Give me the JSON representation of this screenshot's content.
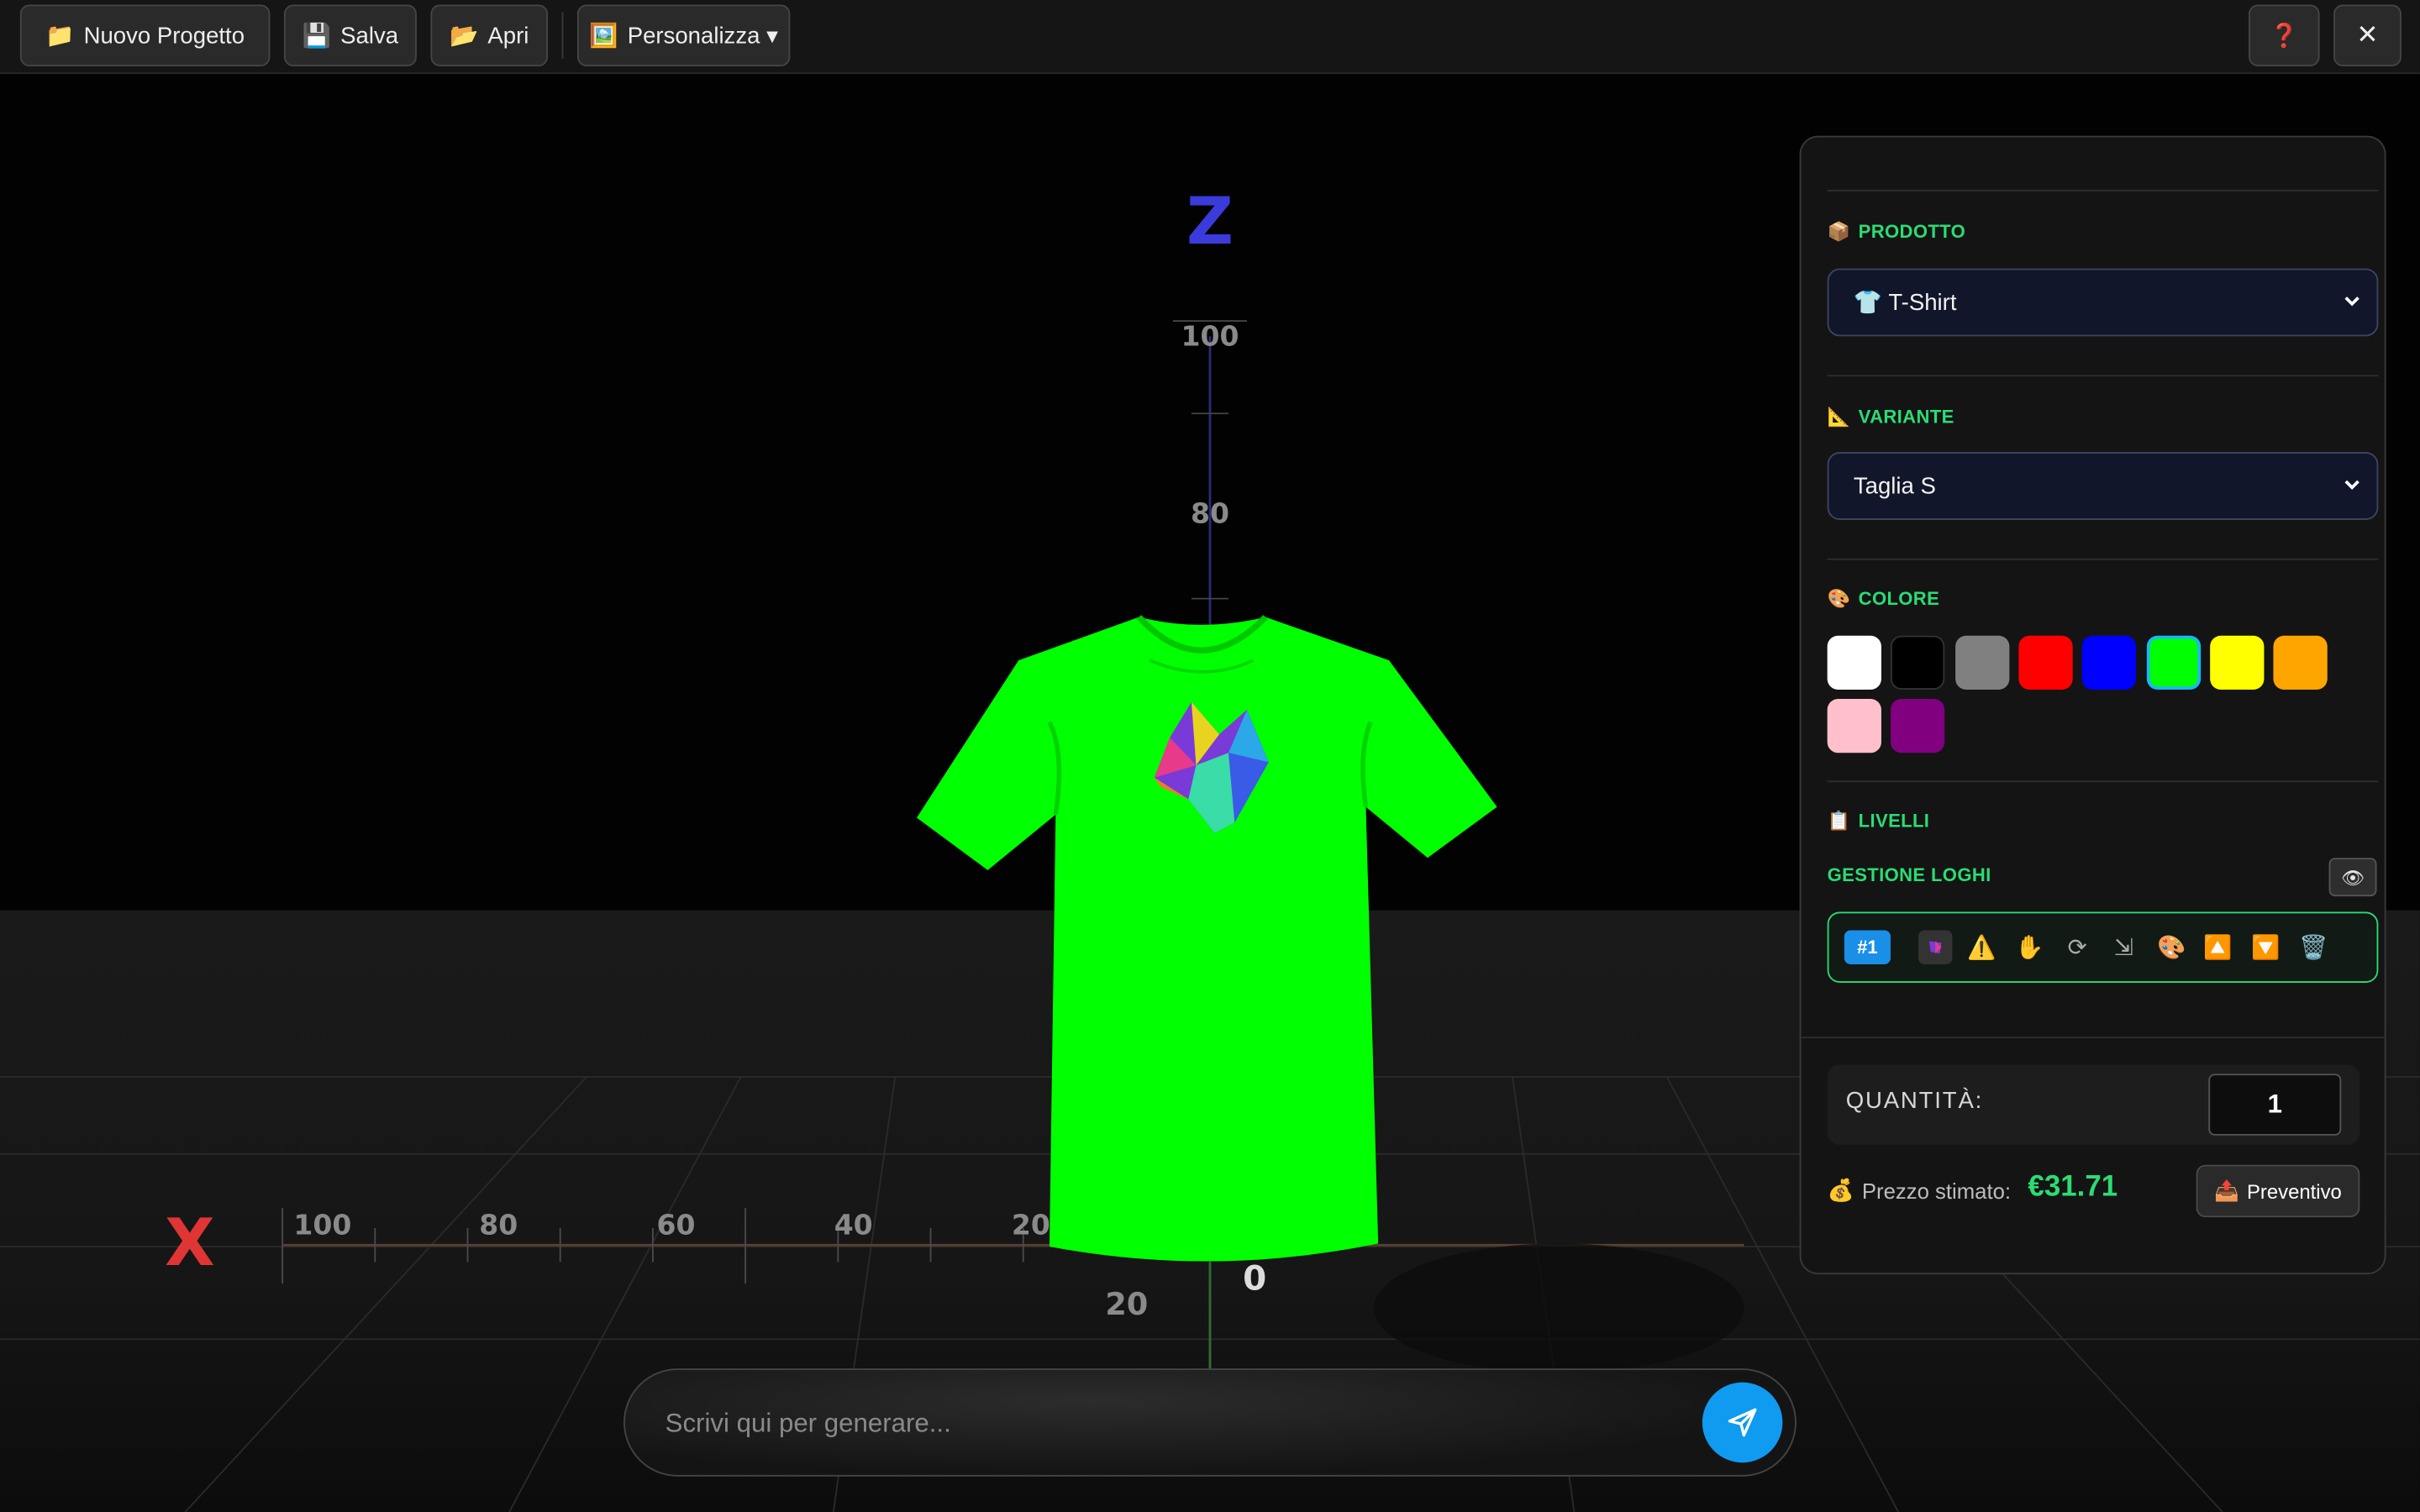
{
  "toolbar": {
    "new_project": "Nuovo Progetto",
    "save": "Salva",
    "open": "Apri",
    "customize": "Personalizza ▾",
    "help_icon": "❓",
    "close_icon": "✕"
  },
  "scene": {
    "axis_z": "Z",
    "axis_x": "X",
    "z_ticks": [
      "100",
      "80"
    ],
    "x_ticks": [
      "100",
      "80",
      "60",
      "40",
      "20"
    ],
    "origin_label": "0",
    "y_tick": "20",
    "garment_color": "#00ff00"
  },
  "panel": {
    "product_label": "PRODOTTO",
    "product_icon": "📦",
    "product_value": "👕 T-Shirt",
    "variant_label": "VARIANTE",
    "variant_icon": "📐",
    "variant_value": "Taglia S",
    "color_label": "COLORE",
    "color_icon": "🎨",
    "colors": [
      "#ffffff",
      "#000000",
      "#808080",
      "#ff0000",
      "#0000ff",
      "#00ff00",
      "#ffff00",
      "#ffa500",
      "#ffc0cb",
      "#800080"
    ],
    "selected_color": "#00ff00",
    "layers_label": "LIVELLI",
    "layers_icon": "📋",
    "logo_management": "GESTIONE LOGHI",
    "eye_icon": "👁",
    "layer_badge": "#1",
    "layer_tools": [
      "⚠️",
      "✋",
      "⟳",
      "⇲",
      "🎨",
      "🔼",
      "🔽",
      "🗑️"
    ],
    "quantity_label": "QUANTITÀ:",
    "quantity_value": "1",
    "price_icon": "💰",
    "price_label": "Prezzo stimato:",
    "price_value": "€31.71",
    "quote_icon": "📤",
    "quote_button": "Preventivo"
  },
  "prompt": {
    "placeholder": "Scrivi qui per generare..."
  }
}
